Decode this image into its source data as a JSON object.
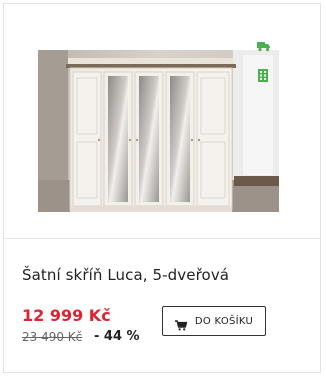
{
  "product": {
    "title": "Šatní skříň Luca, 5-dveřová",
    "price": "12 999 Kč",
    "old_price": "23 490 Kč",
    "discount": "- 44 %",
    "image_alt": "wardrobe-photo"
  },
  "cart_button": {
    "label": "DO KOŠÍKU",
    "icon": "cart-icon"
  },
  "badges": [
    {
      "icon": "delivery-truck-icon"
    },
    {
      "icon": "store-building-icon"
    }
  ],
  "colors": {
    "price": "#e0232f",
    "badge_green": "#4caf50",
    "border": "#e2e2e2"
  }
}
